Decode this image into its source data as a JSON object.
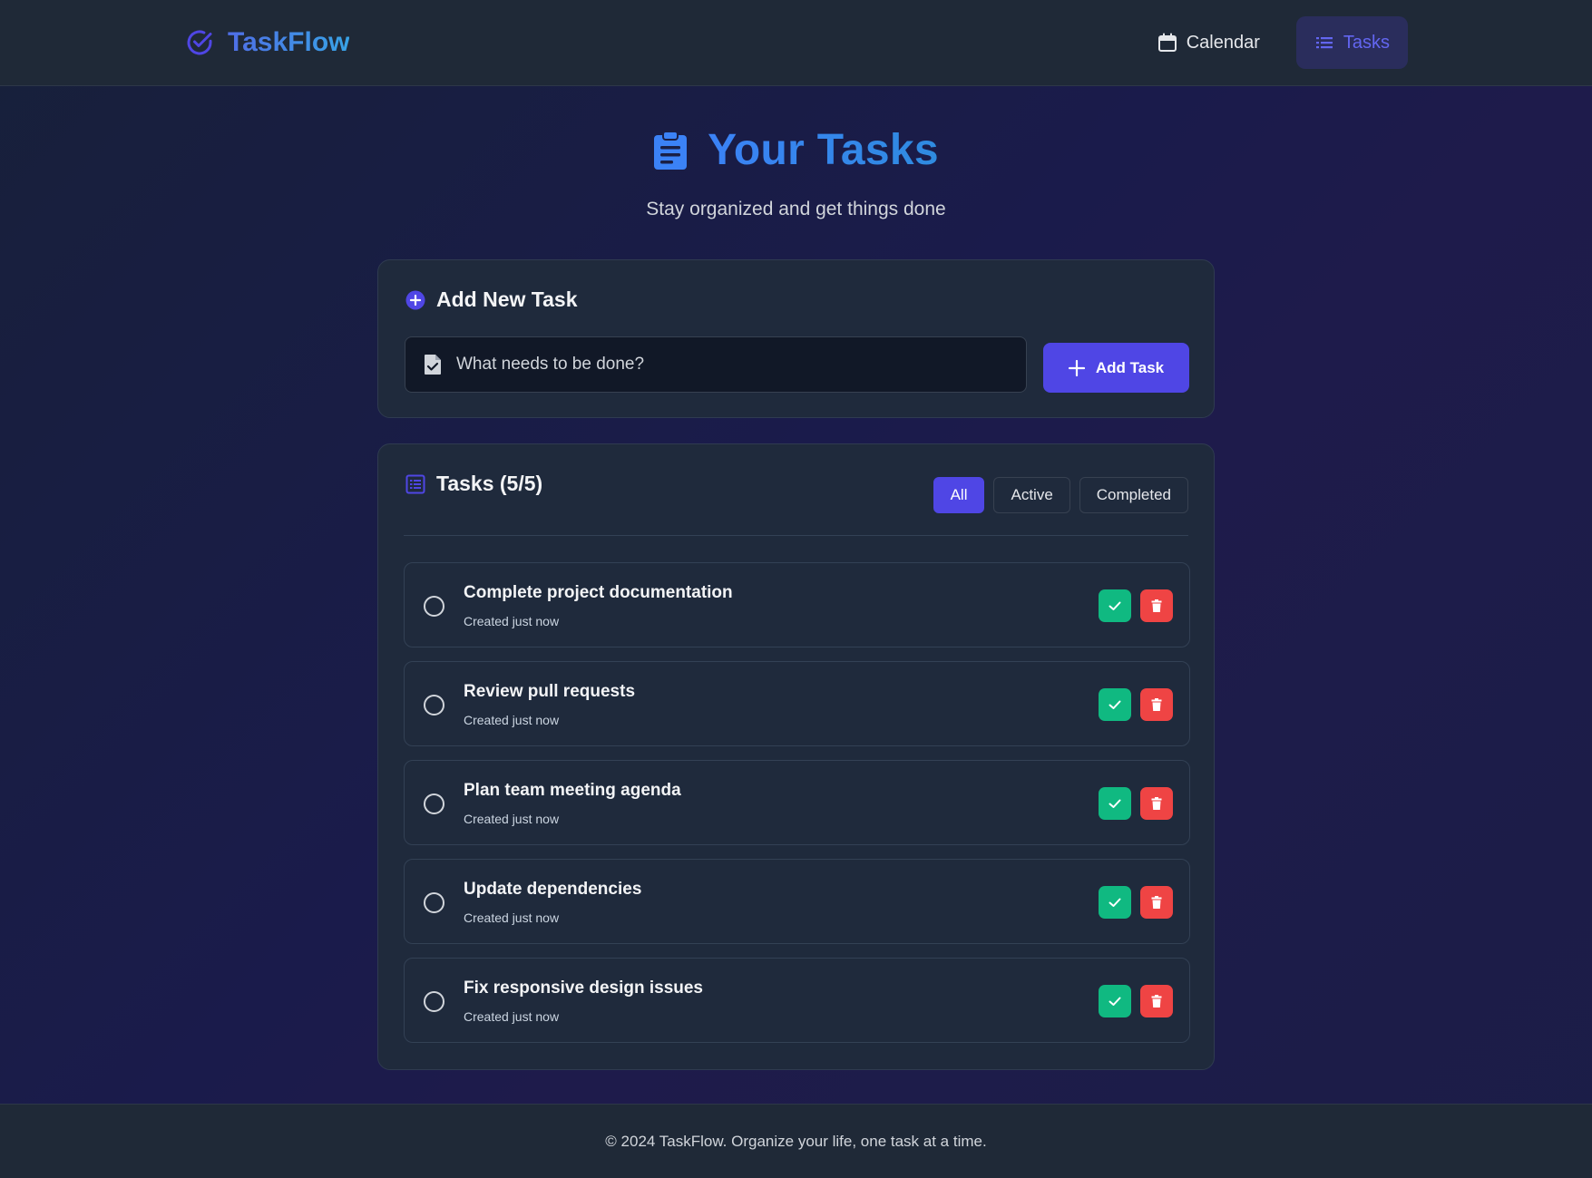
{
  "app": {
    "name": "TaskFlow"
  },
  "nav": {
    "calendar_label": "Calendar",
    "tasks_label": "Tasks",
    "active": "tasks"
  },
  "hero": {
    "title": "Your Tasks",
    "subtitle": "Stay organized and get things done"
  },
  "add_task": {
    "heading": "Add New Task",
    "input_placeholder": "What needs to be done?",
    "input_value": "",
    "button_label": "Add Task"
  },
  "task_list": {
    "heading": "Tasks (5/5)",
    "filters": [
      "All",
      "Active",
      "Completed"
    ],
    "active_filter": "All",
    "tasks": [
      {
        "title": "Complete project documentation",
        "meta": "Created just now",
        "completed": false
      },
      {
        "title": "Review pull requests",
        "meta": "Created just now",
        "completed": false
      },
      {
        "title": "Plan team meeting agenda",
        "meta": "Created just now",
        "completed": false
      },
      {
        "title": "Update dependencies",
        "meta": "Created just now",
        "completed": false
      },
      {
        "title": "Fix responsive design issues",
        "meta": "Created just now",
        "completed": false
      }
    ]
  },
  "footer": {
    "text": "© 2024 TaskFlow. Organize your life, one task at a time."
  },
  "colors": {
    "accent": "#4f46e5",
    "brand_blue": "#3b82f6",
    "complete_green": "#10b981",
    "delete_red": "#ef4444"
  },
  "icons": {
    "brand": "check-circle-icon",
    "calendar": "calendar-icon",
    "tasks": "list-icon",
    "hero": "clipboard-icon",
    "add_heading": "plus-circle-icon",
    "input": "file-edit-icon",
    "add_button": "plus-icon",
    "list_heading": "list-alt-icon",
    "complete": "check-icon",
    "delete": "trash-icon"
  }
}
